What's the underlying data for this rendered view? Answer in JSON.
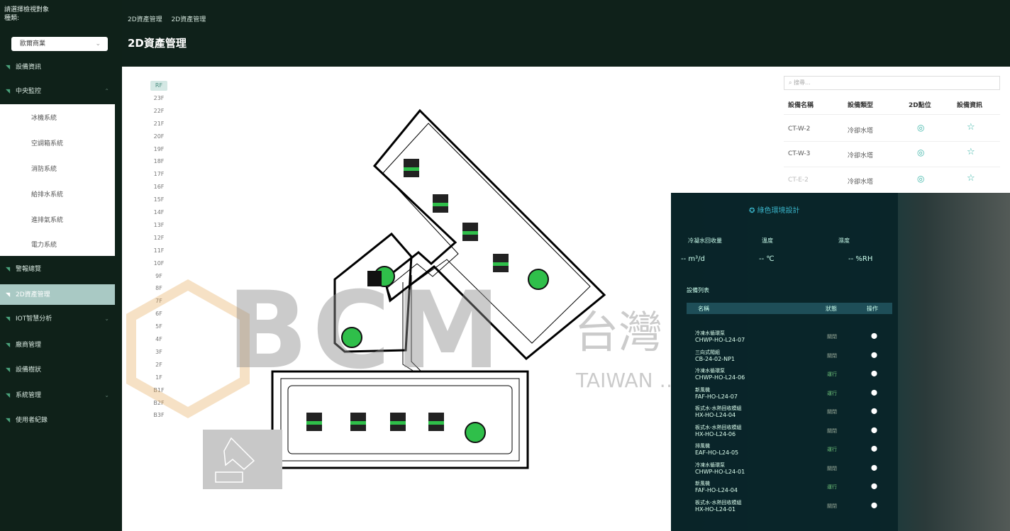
{
  "sidebar": {
    "prompt_line1": "請選擇檢視對象",
    "prompt_line2": "種類:",
    "select_value": "歐爾商業",
    "items": [
      {
        "label": "設備資訊"
      },
      {
        "label": "中央監控"
      },
      {
        "label": "警報總覽"
      },
      {
        "label": "2D資產管理"
      },
      {
        "label": "IOT智慧分析"
      },
      {
        "label": "廠商管理"
      },
      {
        "label": "設備樹狀"
      },
      {
        "label": "系統管理"
      },
      {
        "label": "使用者紀錄"
      }
    ],
    "submenu": [
      "冰機系統",
      "空調箱系統",
      "消防系統",
      "給排水系統",
      "進排氣系統",
      "電力系統"
    ]
  },
  "breadcrumb": [
    "2D資產管理",
    "2D資產管理"
  ],
  "page_title": "2D資產管理",
  "floors": [
    "RF",
    "23F",
    "22F",
    "21F",
    "20F",
    "19F",
    "18F",
    "17F",
    "16F",
    "15F",
    "14F",
    "13F",
    "12F",
    "11F",
    "10F",
    "9F",
    "8F",
    "7F",
    "6F",
    "5F",
    "4F",
    "3F",
    "2F",
    "1F",
    "B1F",
    "B2F",
    "B3F"
  ],
  "table": {
    "search_placeholder": "搜尋...",
    "columns": [
      "設備名稱",
      "設備類型",
      "2D點位",
      "設備資訊"
    ],
    "rows": [
      {
        "name": "CT-W-2",
        "type": "冷卻水塔"
      },
      {
        "name": "CT-W-3",
        "type": "冷卻水塔"
      },
      {
        "name": "CT-E-2",
        "type": "冷卻水塔"
      }
    ]
  },
  "watermark": {
    "logo": "BCM",
    "cn": "台灣 … 居環境 …",
    "en": "TAIWAN … F BUILT"
  },
  "overlay": {
    "title": "綠色環境設計",
    "labels": [
      "冷凝水回收量",
      "溫度",
      "濕度"
    ],
    "units": [
      "m³/d",
      "℃",
      "%RH"
    ],
    "dash": "--",
    "list_title": "設備列表",
    "header": [
      "名稱",
      "狀態",
      "操作"
    ],
    "rows": [
      {
        "l1": "冷凍水循環泵",
        "l2": "CHWP-HO-L24-07",
        "st": "關閉"
      },
      {
        "l1": "三向式閥組",
        "l2": "CB-24-02-NP1",
        "st": "關閉"
      },
      {
        "l1": "冷凍水循環泵",
        "l2": "CHWP-HO-L24-06",
        "st": "運行"
      },
      {
        "l1": "新風機",
        "l2": "FAF-HO-L24-07",
        "st": "運行"
      },
      {
        "l1": "板式水-水熱回收模組",
        "l2": "HX-HO-L24-04",
        "st": "關閉"
      },
      {
        "l1": "板式水-水熱回收模組",
        "l2": "HX-HO-L24-06",
        "st": "關閉"
      },
      {
        "l1": "排風機",
        "l2": "EAF-HO-L24-05",
        "st": "運行"
      },
      {
        "l1": "冷凍水循環泵",
        "l2": "CHWP-HO-L24-01",
        "st": "關閉"
      },
      {
        "l1": "新風機",
        "l2": "FAF-HO-L24-04",
        "st": "運行"
      },
      {
        "l1": "板式水-水熱回收模組",
        "l2": "HX-HO-L24-01",
        "st": "關閉"
      }
    ]
  }
}
